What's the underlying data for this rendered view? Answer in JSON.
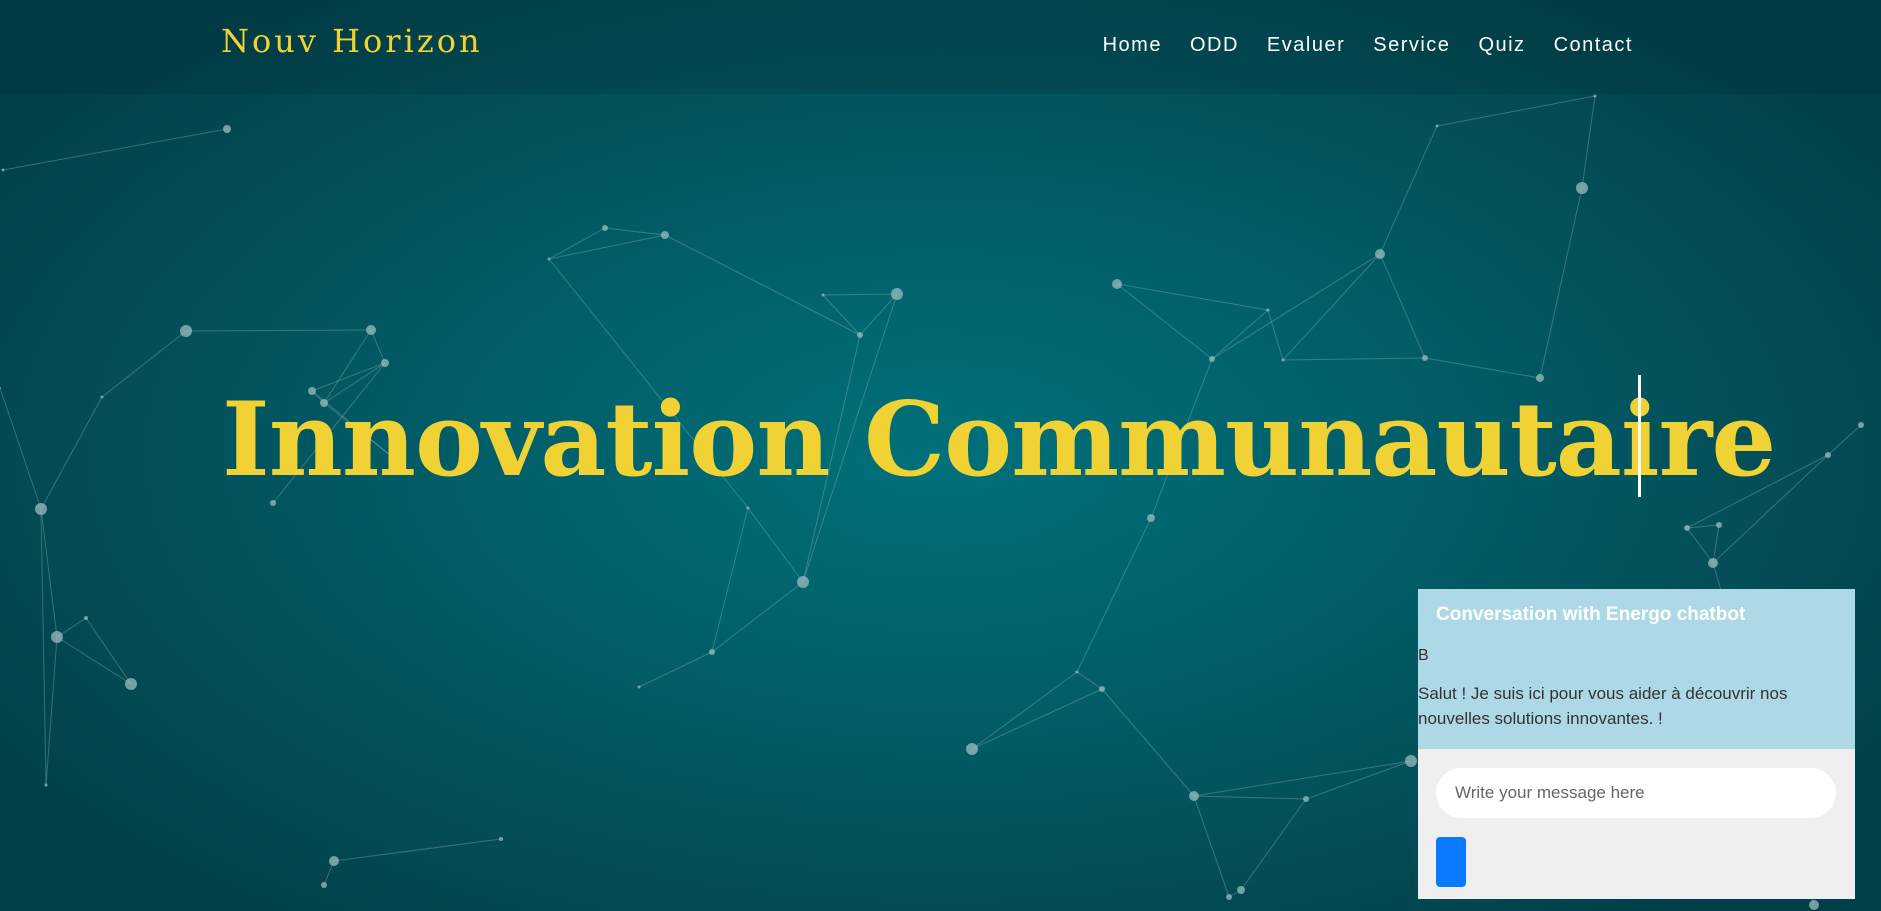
{
  "brand": {
    "name": "Nouv Horizon",
    "color": "#f0d234"
  },
  "nav": {
    "items": [
      {
        "label": "Home"
      },
      {
        "label": "ODD"
      },
      {
        "label": "Evaluer"
      },
      {
        "label": "Service"
      },
      {
        "label": "Quiz"
      },
      {
        "label": "Contact"
      }
    ]
  },
  "hero": {
    "title": "Innovation Communautaire"
  },
  "chat": {
    "header": "Conversation with Energo chatbot",
    "sender": "B",
    "message": "Salut ! Je suis ici pour vous aider à découvrir nos nouvelles solutions innovantes. !",
    "input_placeholder": "Write your message here",
    "input_value": "",
    "send_icon": "send-icon",
    "accent": "#0a7bff",
    "panel_color": "#add8e6"
  },
  "colors": {
    "background": "#025c66",
    "title": "#f0d234",
    "network": "#9bbcc0"
  }
}
